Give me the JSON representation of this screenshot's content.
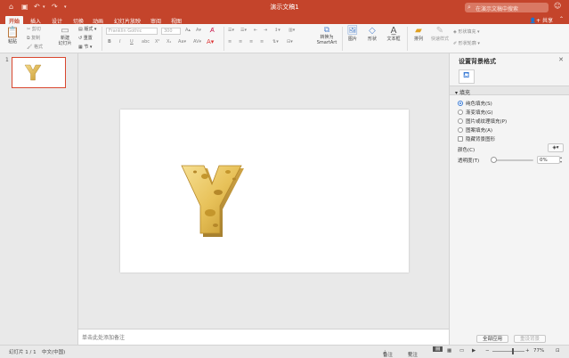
{
  "window": {
    "title": "演示文稿1"
  },
  "search": {
    "placeholder": "在演示文稿中搜索"
  },
  "tabs": [
    "开始",
    "插入",
    "设计",
    "切换",
    "动画",
    "幻灯片放映",
    "审阅",
    "视图"
  ],
  "share": "共享",
  "ribbon": {
    "paste": "粘贴",
    "cut": "剪切",
    "copy": "复制",
    "format": "格式",
    "new_slide": "新建\n幻灯片",
    "layout": "版式",
    "reset": "重置",
    "section": "节",
    "font_name": "Franklin Gothic",
    "font_size": "300",
    "convert_smartart": "转换为\nSmartArt",
    "picture": "图片",
    "shape": "形状",
    "textbox": "文本框",
    "arrange": "排列",
    "quick_styles": "快速样式",
    "shape_fill": "形状填充",
    "shape_outline": "形状轮廓"
  },
  "thumbnail": {
    "number": "1",
    "letter": "Y"
  },
  "slide": {
    "letter": "Y"
  },
  "notes": {
    "placeholder": "单击此处添加备注"
  },
  "pane": {
    "title": "设置背景格式",
    "section": "填充",
    "options": [
      "纯色填充(S)",
      "渐变填充(G)",
      "图片或纹理填充(P)",
      "图案填充(A)",
      "隐藏背景图形"
    ],
    "color_label": "颜色(C)",
    "transparency_label": "透明度(T)",
    "transparency_value": "0%",
    "apply_all": "全部应用",
    "reset_bg": "重设背景"
  },
  "status": {
    "slide_count": "幻灯片 1 / 1",
    "language": "中文(中国)",
    "notes": "备注",
    "comments": "批注",
    "zoom": "77%"
  },
  "colors": {
    "accent": "#c4442b",
    "cheese": "#e8c25a"
  }
}
